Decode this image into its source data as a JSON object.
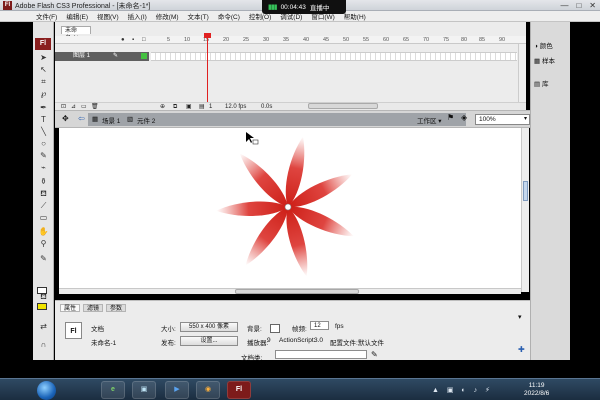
{
  "window": {
    "title": "Adobe Flash CS3 Professional - [未命名-1*]",
    "controls": [
      "—",
      "□",
      "✕"
    ]
  },
  "recording": {
    "time": "00:04:43",
    "status": "直播中",
    "signal_icon": "signal-bars-icon"
  },
  "menu": [
    "文件(F)",
    "编辑(E)",
    "视图(V)",
    "插入(I)",
    "修改(M)",
    "文本(T)",
    "命令(C)",
    "控制(O)",
    "调试(D)",
    "窗口(W)",
    "帮助(H)"
  ],
  "timeline": {
    "doc_tab": "未命名-1*",
    "frame_numbers": [
      "5",
      "10",
      "15",
      "20",
      "25",
      "30",
      "35",
      "40",
      "45",
      "50",
      "55",
      "60",
      "65",
      "70",
      "75",
      "80",
      "85",
      "90",
      "95",
      "100",
      "105"
    ],
    "layer_name": "图层 1",
    "current_frame": "1",
    "fps": "12.0 fps",
    "time": "0.0s"
  },
  "editbar": {
    "scene": "场景 1",
    "symbol": "元件 2",
    "workspace_label": "工作区",
    "zoom": "100%"
  },
  "stage": {
    "flower_color": "#d9241e",
    "petals": 7
  },
  "properties": {
    "tabs": [
      "属性",
      "滤镜",
      "参数"
    ],
    "doc_type": "文档",
    "doc_name": "未命名-1",
    "size_label": "大小:",
    "size_value": "550 x 400 像素",
    "publish_label": "发布:",
    "settings_button": "设置...",
    "bg_label": "背景:",
    "fps_label": "帧频:",
    "fps_value": "12",
    "fps_unit": "fps",
    "player_label": "播放器:",
    "player_value": "9",
    "as_label": "ActionScript:",
    "as_value": "3.0",
    "profile_label": "配置文件:",
    "profile_value": "默认文件",
    "doc_class_label": "文档类:"
  },
  "right_panels": [
    "颜色",
    "样本",
    "库"
  ],
  "toolbox": {
    "logo": "Fl"
  },
  "taskbar": {
    "apps": [
      "e",
      "▣",
      "▶",
      "◉",
      "Fl"
    ],
    "clock_time": "11:19",
    "clock_date": "2022/8/6"
  }
}
